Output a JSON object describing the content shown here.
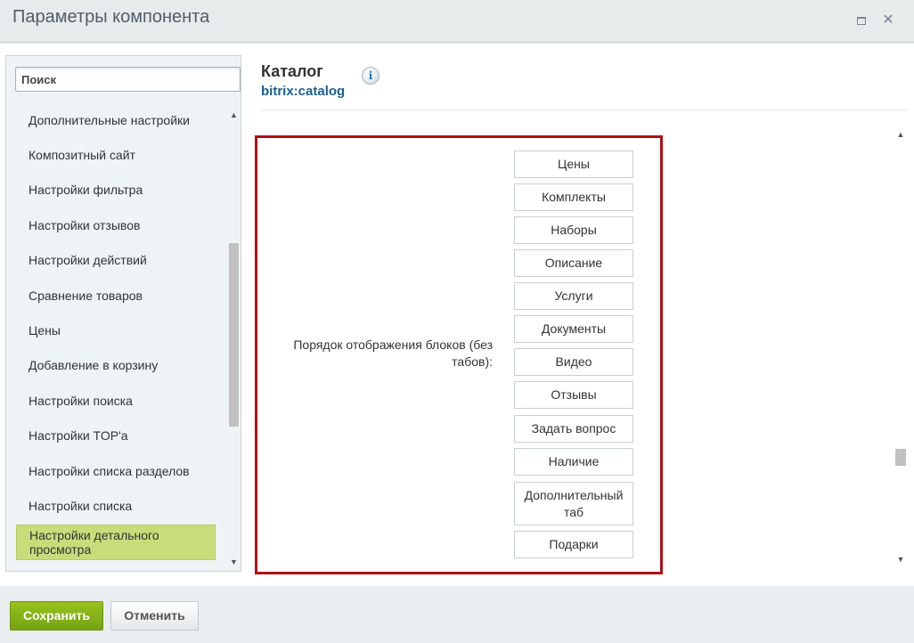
{
  "window": {
    "title": "Параметры компонента",
    "maximize_icon": "maximize-icon",
    "close_symbol": "✕"
  },
  "sidebar": {
    "search_placeholder": "Поиск",
    "scroll_up": "▲",
    "scroll_down": "▼",
    "items": [
      {
        "label": "Дополнительные настройки"
      },
      {
        "label": "Композитный сайт"
      },
      {
        "label": "Настройки фильтра"
      },
      {
        "label": "Настройки отзывов"
      },
      {
        "label": "Настройки действий"
      },
      {
        "label": "Сравнение товаров"
      },
      {
        "label": "Цены"
      },
      {
        "label": "Добавление в корзину"
      },
      {
        "label": "Настройки поиска"
      },
      {
        "label": "Настройки TOP'а"
      },
      {
        "label": "Настройки списка разделов"
      },
      {
        "label": "Настройки списка"
      },
      {
        "label": "Настройки детального просмотра",
        "active": true
      }
    ]
  },
  "header": {
    "title": "Каталог",
    "component_code": "bitrix:catalog",
    "info_symbol": "i"
  },
  "param": {
    "label": "Порядок отображения блоков (без табов):",
    "blocks": [
      {
        "label": "Цены"
      },
      {
        "label": "Комплекты"
      },
      {
        "label": "Наборы"
      },
      {
        "label": "Описание"
      },
      {
        "label": "Услуги"
      },
      {
        "label": "Документы"
      },
      {
        "label": "Видео"
      },
      {
        "label": "Отзывы"
      },
      {
        "label": "Задать вопрос"
      },
      {
        "label": "Наличие"
      },
      {
        "label": "Дополнительный таб"
      },
      {
        "label": "Подарки"
      }
    ]
  },
  "main_scroll": {
    "up": "▲",
    "down": "▼"
  },
  "footer": {
    "save_label": "Сохранить",
    "cancel_label": "Отменить"
  },
  "colors": {
    "accent_green": "#7fac16",
    "highlight_border": "#b01014",
    "active_item_bg": "#c6dd7a",
    "link_blue": "#1d5e8c"
  }
}
